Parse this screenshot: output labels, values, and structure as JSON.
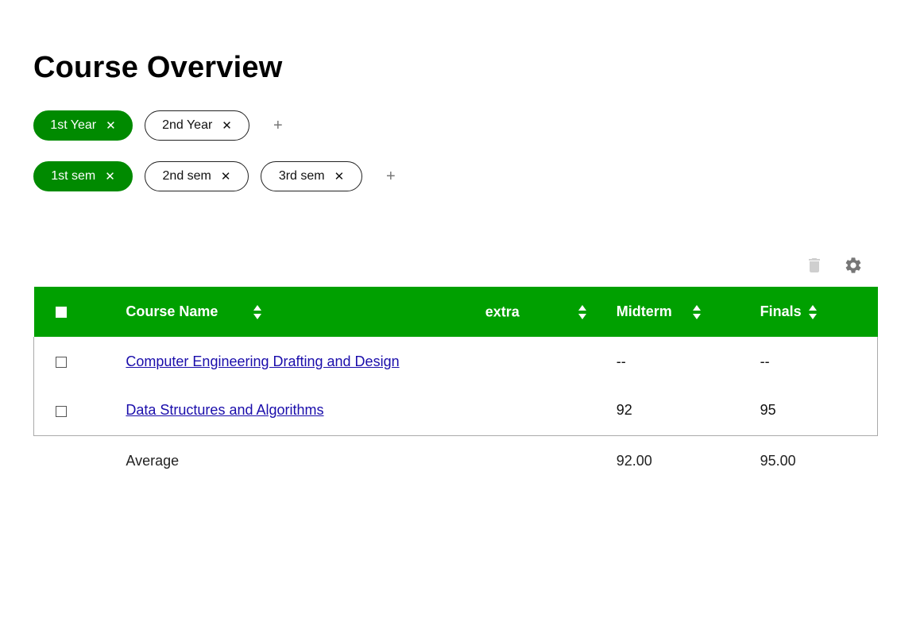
{
  "page": {
    "title": "Course Overview"
  },
  "years": {
    "chips": [
      {
        "label": "1st Year",
        "active": true
      },
      {
        "label": "2nd Year",
        "active": false
      }
    ],
    "add_label": "+"
  },
  "semesters": {
    "chips": [
      {
        "label": "1st sem",
        "active": true
      },
      {
        "label": "2nd sem",
        "active": false
      },
      {
        "label": "3rd sem",
        "active": false
      }
    ],
    "add_label": "+"
  },
  "chip_close_glyph": "✕",
  "toolbar": {
    "delete_icon": "trash-icon",
    "settings_icon": "gear-icon"
  },
  "table": {
    "headers": {
      "course": "Course Name",
      "extra": "extra",
      "midterm": "Midterm",
      "finals": "Finals"
    },
    "rows": [
      {
        "course": "Computer Engineering Drafting and Design",
        "extra": "",
        "midterm": "--",
        "finals": "--"
      },
      {
        "course": "Data Structures and Algorithms",
        "extra": "",
        "midterm": "92",
        "finals": "95"
      }
    ],
    "footer": {
      "label": "Average",
      "midterm": "92.00",
      "finals": "95.00"
    }
  },
  "colors": {
    "header_bg": "#00a000",
    "chip_active": "#008a00",
    "link": "#1a0dab"
  }
}
